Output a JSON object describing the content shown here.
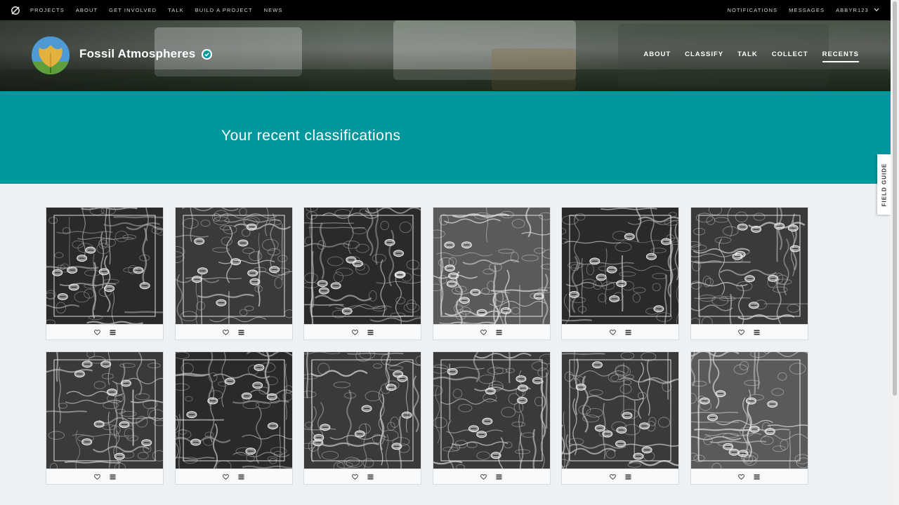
{
  "site_nav": {
    "left": [
      "PROJECTS",
      "ABOUT",
      "GET INVOLVED",
      "TALK",
      "BUILD A PROJECT",
      "NEWS"
    ],
    "right": [
      "NOTIFICATIONS",
      "MESSAGES",
      "ABBYR123"
    ]
  },
  "project": {
    "title": "Fossil Atmospheres",
    "nav": [
      "ABOUT",
      "CLASSIFY",
      "TALK",
      "COLLECT",
      "RECENTS"
    ],
    "active_nav": "RECENTS"
  },
  "page": {
    "heading": "Your recent classifications"
  },
  "field_guide": {
    "label": "FIELD GUIDE"
  },
  "icons": {
    "zooniverse_logo": "zooniverse-logo-icon",
    "verified": "verified-check-icon",
    "favorite": "heart-icon",
    "collect": "list-icon",
    "user_menu": "chevron-down-icon"
  },
  "colors": {
    "hero_teal": "#00979d",
    "top_bar": "#000000",
    "page_bg": "#eef1f4"
  },
  "recents": {
    "count": 12,
    "items": [
      {
        "tone": "dark"
      },
      {
        "tone": "mid"
      },
      {
        "tone": "dark"
      },
      {
        "tone": "light"
      },
      {
        "tone": "dark"
      },
      {
        "tone": "mid"
      },
      {
        "tone": "mid"
      },
      {
        "tone": "dark"
      },
      {
        "tone": "mid"
      },
      {
        "tone": "mid"
      },
      {
        "tone": "mid"
      },
      {
        "tone": "light"
      }
    ]
  }
}
